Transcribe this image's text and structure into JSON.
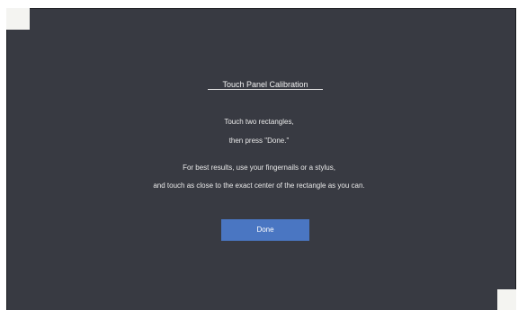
{
  "dialog": {
    "title": "Touch Panel Calibration",
    "instructions": [
      "Touch two rectangles,",
      "then press \"Done.\"",
      "For best results, use your fingernails or a stylus,",
      "and touch as close to the exact center of the rectangle as you can."
    ],
    "done_label": "Done"
  },
  "colors": {
    "background": "#383a42",
    "button": "#4a76c2",
    "target": "#f4f4f1"
  }
}
